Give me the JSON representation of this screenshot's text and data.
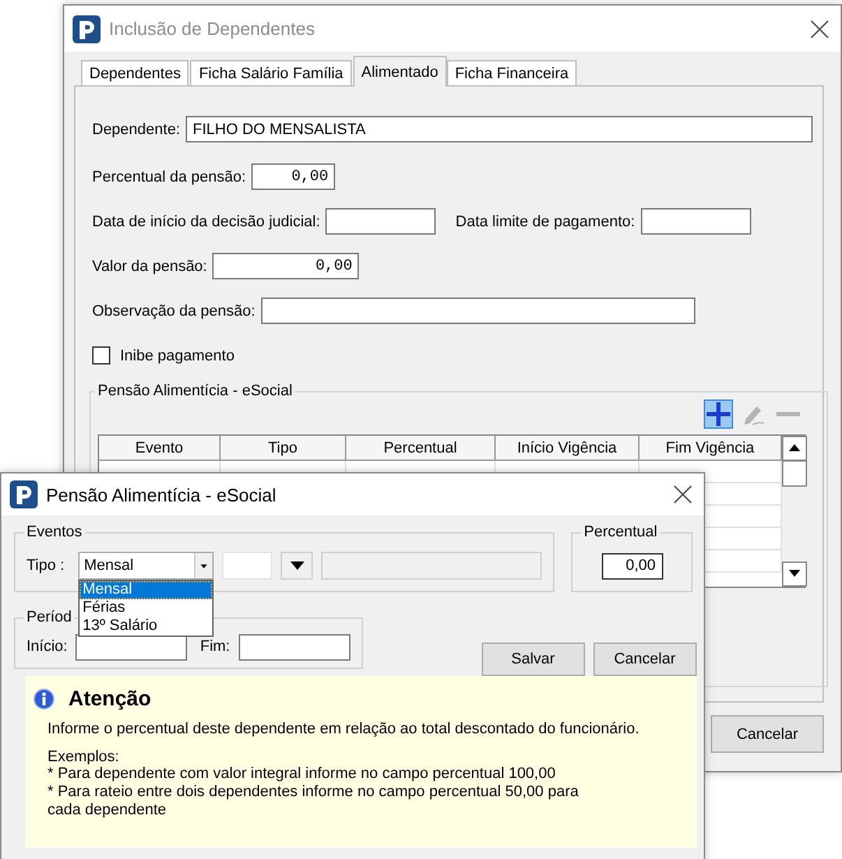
{
  "window": {
    "title": "Inclusão de Dependentes"
  },
  "tabs": [
    {
      "label": "Dependentes",
      "selected": false
    },
    {
      "label": "Ficha Salário Família",
      "selected": false
    },
    {
      "label": "Alimentado",
      "selected": true
    },
    {
      "label": "Ficha Financeira",
      "selected": false
    }
  ],
  "form": {
    "dependente": {
      "label": "Dependente:",
      "value": "FILHO DO MENSALISTA"
    },
    "percentual": {
      "label": "Percentual da pensão:",
      "value": "0,00"
    },
    "data_inicio": {
      "label": "Data de início da decisão judicial:"
    },
    "data_limite": {
      "label": "Data limite de pagamento:"
    },
    "valor": {
      "label": "Valor da pensão:",
      "value": "0,00"
    },
    "observacao": {
      "label": "Observação da pensão:"
    },
    "inibe": {
      "label": "Inibe pagamento",
      "checked": false
    }
  },
  "esocial_group": {
    "title": "Pensão Alimentícia - eSocial",
    "toolbar": [
      {
        "kind": "add",
        "disabled": false
      },
      {
        "kind": "edit",
        "disabled": true
      },
      {
        "kind": "remove",
        "disabled": true
      }
    ],
    "table": {
      "columns": [
        "Evento",
        "Tipo",
        "Percentual",
        "Início Vigência",
        "Fim Vigência"
      ]
    }
  },
  "buttons": [
    "Cancelar"
  ],
  "dialog": {
    "title": "Pensão Alimentícia - eSocial",
    "eventos": {
      "title": "Eventos",
      "tipo_label": "Tipo :",
      "tipo_value": "Mensal",
      "options": [
        {
          "label": "Mensal",
          "selected": true
        },
        {
          "label": "Férias",
          "selected": false
        },
        {
          "label": "13º Salário",
          "selected": false
        }
      ]
    },
    "percentual": {
      "title": "Percentual",
      "value": "0,00"
    },
    "periodo": {
      "title": "Períod",
      "inicio_label": "Início:",
      "fim_label": "Fim:"
    },
    "buttons": [
      "Salvar",
      "Cancelar"
    ],
    "notice": {
      "title": "Atenção",
      "text": "Informe o percentual deste dependente em relação ao total descontado do funcionário.",
      "examples_label": "Exemplos:",
      "examples": [
        {
          "bullet": "*",
          "text": "Para dependente com valor integral informe no campo percentual 100,00"
        },
        {
          "bullet": "*",
          "text": "Para rateio entre dois dependentes informe no campo percentual 50,00 para cada dependente"
        }
      ]
    }
  }
}
